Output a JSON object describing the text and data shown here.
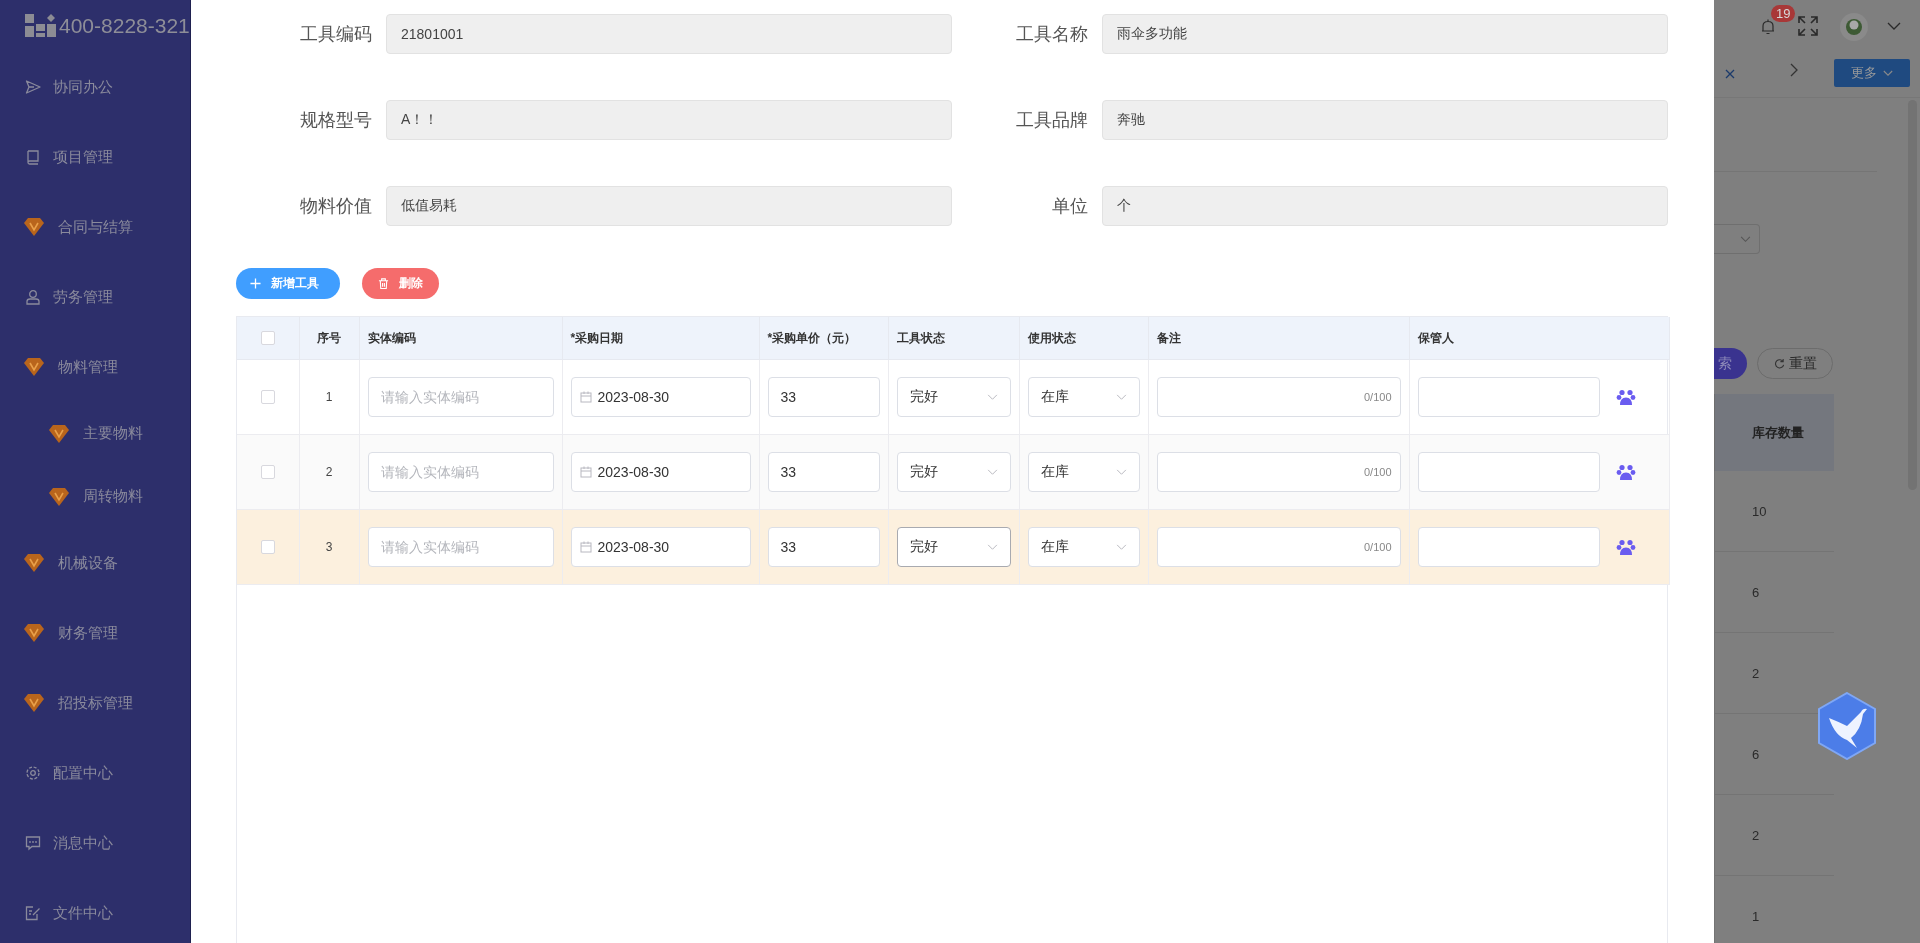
{
  "sidebar": {
    "logo_text": "400-8228-321",
    "items": [
      {
        "label": "协同办公",
        "kind": "send"
      },
      {
        "label": "项目管理",
        "kind": "book"
      },
      {
        "label": "合同与结算",
        "kind": "gem"
      },
      {
        "label": "劳务管理",
        "kind": "user"
      },
      {
        "label": "物料管理",
        "kind": "gem",
        "children": [
          {
            "label": "主要物料",
            "kind": "gem"
          },
          {
            "label": "周转物料",
            "kind": "gem"
          }
        ]
      },
      {
        "label": "机械设备",
        "kind": "gem"
      },
      {
        "label": "财务管理",
        "kind": "gem"
      },
      {
        "label": "招投标管理",
        "kind": "gem"
      },
      {
        "label": "配置中心",
        "kind": "gear"
      },
      {
        "label": "消息中心",
        "kind": "chat"
      },
      {
        "label": "文件中心",
        "kind": "edit"
      }
    ]
  },
  "form": {
    "fields": [
      {
        "label": "工具编码",
        "value": "21801001"
      },
      {
        "label": "工具名称",
        "value": "雨伞多功能"
      },
      {
        "label": "规格型号",
        "value": "A！！"
      },
      {
        "label": "工具品牌",
        "value": "奔驰"
      },
      {
        "label": "物料价值",
        "value": "低值易耗"
      },
      {
        "label": "单位",
        "value": "个"
      }
    ]
  },
  "actions": [
    {
      "label": "新增工具",
      "kind": "add"
    },
    {
      "label": "删除",
      "kind": "delete"
    }
  ],
  "table": {
    "all_checked": false,
    "columns": [
      "序号",
      "实体编码",
      "*采购日期",
      "*采购单价（元）",
      "工具状态",
      "使用状态",
      "备注",
      "保管人"
    ],
    "rows": [
      {
        "index": "1",
        "checked": false,
        "selected": false,
        "code_placeholder": "请输入实体编码",
        "date": "2023-08-30",
        "price": "33",
        "tool_state": {
          "value": "完好",
          "focused": false
        },
        "use_state": "在库",
        "remark_count": "0/100"
      },
      {
        "index": "2",
        "checked": false,
        "selected": false,
        "code_placeholder": "请输入实体编码",
        "date": "2023-08-30",
        "price": "33",
        "tool_state": {
          "value": "完好",
          "focused": false
        },
        "use_state": "在库",
        "remark_count": "0/100"
      },
      {
        "index": "3",
        "checked": false,
        "selected": true,
        "code_placeholder": "请输入实体编码",
        "date": "2023-08-30",
        "price": "33",
        "tool_state": {
          "value": "完好",
          "focused": true
        },
        "use_state": "在库",
        "remark_count": "0/100"
      }
    ]
  },
  "background": {
    "notification_badge": "19",
    "more_button": "更多",
    "search_button": "索",
    "reset_button": "重置",
    "column": "库存数量",
    "values": [
      "10",
      "6",
      "2",
      "6",
      "2",
      "1"
    ]
  }
}
